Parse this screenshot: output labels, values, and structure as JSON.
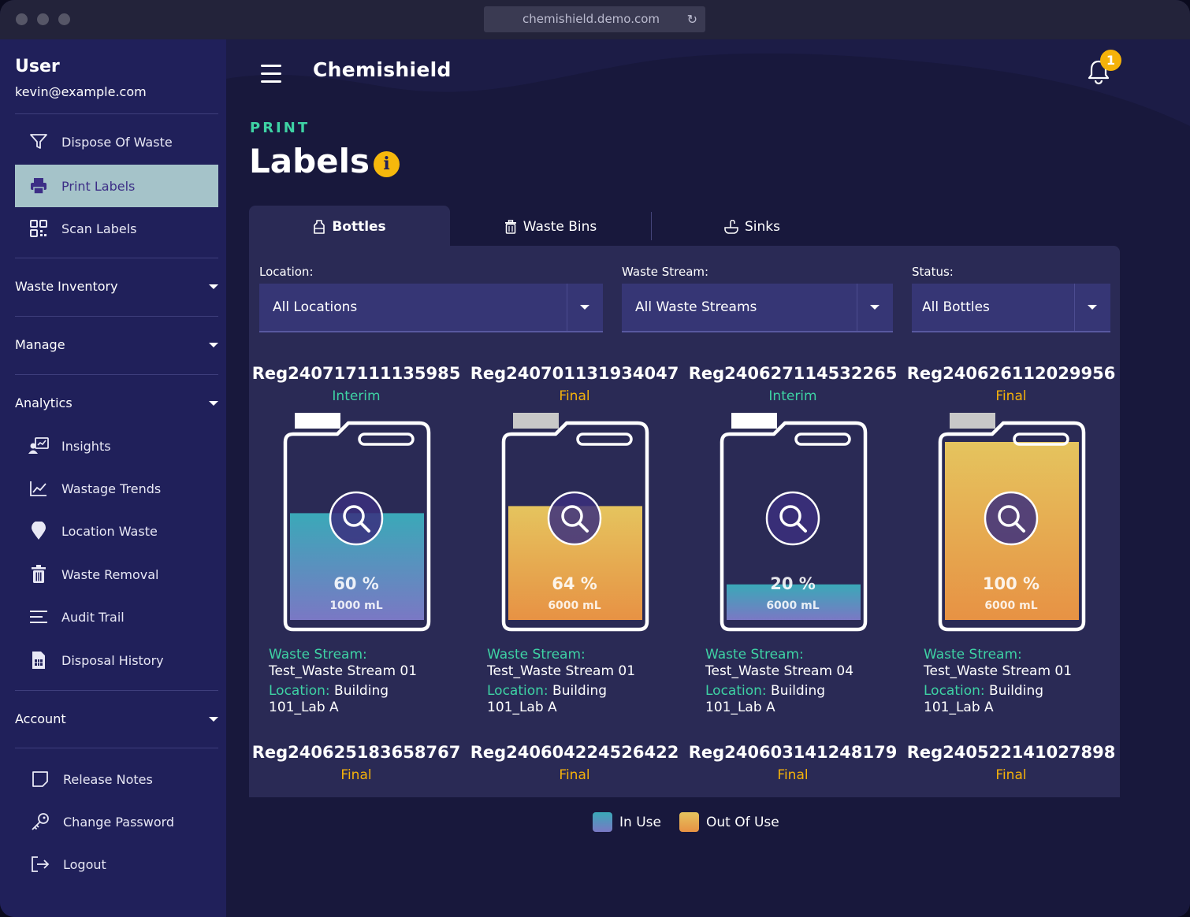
{
  "browser": {
    "url": "chemishield.demo.com"
  },
  "sidebar": {
    "user_title": "User",
    "user_email": "kevin@example.com",
    "top_items": [
      {
        "label": "Dispose Of Waste",
        "icon": "filter-icon"
      },
      {
        "label": "Print Labels",
        "icon": "printer-icon",
        "active": true
      },
      {
        "label": "Scan Labels",
        "icon": "qr-code-icon"
      }
    ],
    "sections": {
      "waste_inventory": "Waste Inventory",
      "manage": "Manage",
      "analytics": "Analytics",
      "account": "Account"
    },
    "analytics_items": [
      {
        "label": "Insights",
        "icon": "insights-icon"
      },
      {
        "label": "Wastage Trends",
        "icon": "line-chart-icon"
      },
      {
        "label": "Location Waste",
        "icon": "map-pin-icon"
      },
      {
        "label": "Waste Removal",
        "icon": "trash-icon"
      },
      {
        "label": "Audit Trail",
        "icon": "list-icon"
      },
      {
        "label": "Disposal History",
        "icon": "document-icon"
      }
    ],
    "account_items": [
      {
        "label": "Release Notes",
        "icon": "notes-icon"
      },
      {
        "label": "Change Password",
        "icon": "key-icon"
      },
      {
        "label": "Logout",
        "icon": "logout-icon"
      }
    ]
  },
  "header": {
    "app_title": "Chemishield",
    "notification_count": "1"
  },
  "page": {
    "kicker": "PRINT",
    "title": "Labels",
    "info_glyph": "i"
  },
  "tabs": [
    {
      "label": "Bottles",
      "active": true
    },
    {
      "label": "Waste Bins"
    },
    {
      "label": "Sinks"
    }
  ],
  "filters": {
    "location": {
      "label": "Location:",
      "value": "All Locations"
    },
    "waste_stream": {
      "label": "Waste Stream:",
      "value": "All Waste Streams"
    },
    "status": {
      "label": "Status:",
      "value": "All Bottles"
    }
  },
  "bottles": [
    {
      "reg": "Reg240717111135985",
      "status": "Interim",
      "fill": 0.6,
      "percent": "60 %",
      "volume": "1000 mL",
      "stream_label": "Waste Stream:",
      "stream": "Test_Waste Stream 01",
      "location_label": "Location:",
      "location_a": "Building",
      "location_b": "101_Lab A",
      "cap_color": "#ffffff",
      "state": "in-use"
    },
    {
      "reg": "Reg240701131934047",
      "status": "Final",
      "fill": 0.64,
      "percent": "64 %",
      "volume": "6000 mL",
      "stream_label": "Waste Stream:",
      "stream": "Test_Waste Stream 01",
      "location_label": "Location:",
      "location_a": "Building",
      "location_b": "101_Lab A",
      "cap_color": "#c8c8c8",
      "state": "out-of-use"
    },
    {
      "reg": "Reg240627114532265",
      "status": "Interim",
      "fill": 0.2,
      "percent": "20 %",
      "volume": "6000 mL",
      "stream_label": "Waste Stream:",
      "stream": "Test_Waste Stream 04",
      "location_label": "Location:",
      "location_a": "Building",
      "location_b": "101_Lab A",
      "cap_color": "#ffffff",
      "state": "in-use"
    },
    {
      "reg": "Reg240626112029956",
      "status": "Final",
      "fill": 1.0,
      "percent": "100 %",
      "volume": "6000 mL",
      "stream_label": "Waste Stream:",
      "stream": "Test_Waste Stream 01",
      "location_label": "Location:",
      "location_a": "Building",
      "location_b": "101_Lab A",
      "cap_color": "#c8c8c8",
      "state": "out-of-use"
    },
    {
      "reg": "Reg240625183658767",
      "status": "Final"
    },
    {
      "reg": "Reg240604224526422",
      "status": "Final"
    },
    {
      "reg": "Reg240603141248179",
      "status": "Final"
    },
    {
      "reg": "Reg240522141027898",
      "status": "Final"
    }
  ],
  "legend": {
    "in_use": "In Use",
    "out_of_use": "Out Of Use"
  },
  "colors": {
    "accent_green": "#3ed2a4",
    "accent_yellow": "#f5b20a",
    "in_use_top": "#3aa9b8",
    "in_use_bottom": "#7a78c4",
    "out_of_use_top": "#e5c45e",
    "out_of_use_bottom": "#e79244"
  }
}
